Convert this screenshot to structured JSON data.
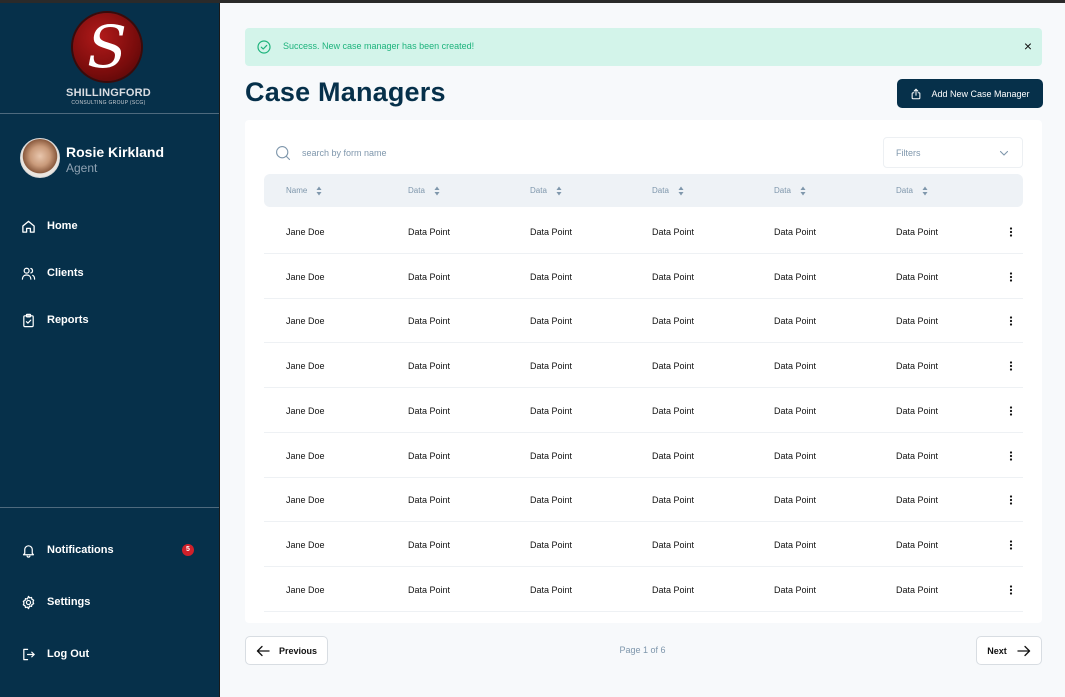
{
  "brand": {
    "logo_letter": "S",
    "name": "SHILLINGFORD",
    "subtitle": "CONSULTING GROUP (SCG)"
  },
  "profile": {
    "name": "Rosie Kirkland",
    "role": "Agent"
  },
  "nav": {
    "home": "Home",
    "clients": "Clients",
    "reports": "Reports",
    "notifications": "Notifications",
    "notifications_count": "5",
    "settings": "Settings",
    "logout": "Log Out"
  },
  "alert": {
    "message": "Success. New case manager has been created!",
    "close": "×"
  },
  "page": {
    "title": "Case Managers",
    "add_button": "Add New Case Manager"
  },
  "search": {
    "placeholder": "search by form name"
  },
  "filters": {
    "label": "Filters"
  },
  "table": {
    "headers": [
      "Name",
      "Data",
      "Data",
      "Data",
      "Data",
      "Data"
    ],
    "rows": [
      [
        "Jane Doe",
        "Data Point",
        "Data Point",
        "Data Point",
        "Data Point",
        "Data Point"
      ],
      [
        "Jane Doe",
        "Data Point",
        "Data Point",
        "Data Point",
        "Data Point",
        "Data Point"
      ],
      [
        "Jane Doe",
        "Data Point",
        "Data Point",
        "Data Point",
        "Data Point",
        "Data Point"
      ],
      [
        "Jane Doe",
        "Data Point",
        "Data Point",
        "Data Point",
        "Data Point",
        "Data Point"
      ],
      [
        "Jane Doe",
        "Data Point",
        "Data Point",
        "Data Point",
        "Data Point",
        "Data Point"
      ],
      [
        "Jane Doe",
        "Data Point",
        "Data Point",
        "Data Point",
        "Data Point",
        "Data Point"
      ],
      [
        "Jane Doe",
        "Data Point",
        "Data Point",
        "Data Point",
        "Data Point",
        "Data Point"
      ],
      [
        "Jane Doe",
        "Data Point",
        "Data Point",
        "Data Point",
        "Data Point",
        "Data Point"
      ],
      [
        "Jane Doe",
        "Data Point",
        "Data Point",
        "Data Point",
        "Data Point",
        "Data Point"
      ]
    ]
  },
  "pagination": {
    "previous": "Previous",
    "info": "Page 1 of 6",
    "next": "Next"
  },
  "colors": {
    "sidebar": "#06304a",
    "primary": "#06304a",
    "success_bg": "#d3f4ea",
    "success_text": "#1db37c",
    "badge": "#d0202a"
  },
  "icons": {
    "home": "home-icon",
    "clients": "users-icon",
    "reports": "clipboard-icon",
    "notifications": "bell-icon",
    "settings": "gear-icon",
    "logout": "logout-icon",
    "search": "search-icon",
    "add": "upload-icon",
    "alert": "check-circle-icon"
  }
}
